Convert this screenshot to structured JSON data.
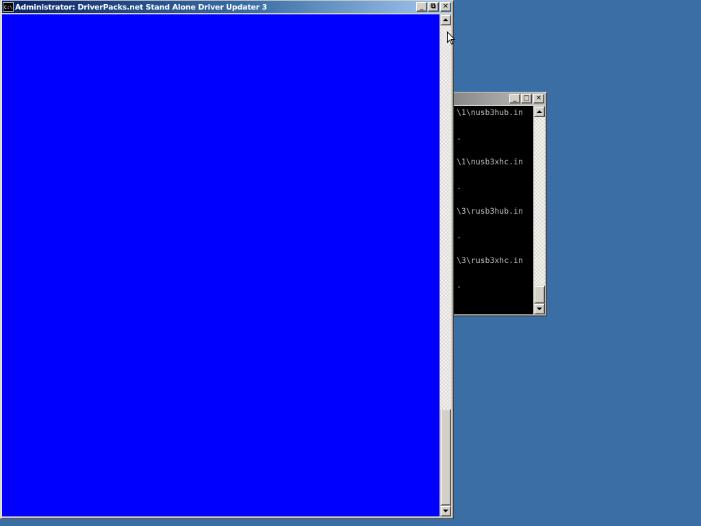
{
  "main_window": {
    "title": "Administrator:  DriverPacks.net Stand Alone Driver Updater 3",
    "icon_label": "C:\\",
    "client_color": "#0000ff",
    "controls": {
      "minimize": "_",
      "restore": "⧉",
      "close": "✕"
    }
  },
  "console_window": {
    "lines": [
      "\\1\\nusb3hub.in",
      ".",
      "\\1\\nusb3xhc.in",
      ".",
      "\\3\\rusb3hub.in",
      ".",
      "\\3\\rusb3xhc.in",
      "."
    ],
    "controls": {
      "minimize": "_",
      "maximize": "□",
      "close": "✕"
    }
  },
  "colors": {
    "desktop": "#3a6ea5",
    "titlebar_active": "#0a246a",
    "console_bg": "#000000",
    "console_text": "#c0c0c0"
  }
}
